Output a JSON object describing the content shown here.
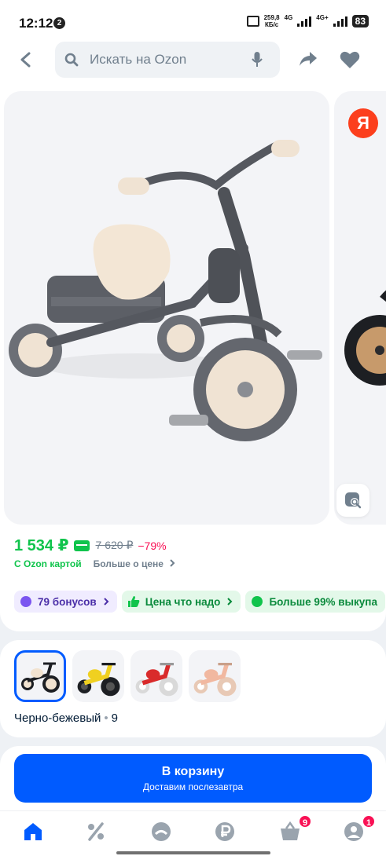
{
  "status_bar": {
    "time": "12:12",
    "notif_count": "2",
    "speed_value": "259,8",
    "speed_unit": "КБ/с",
    "net1": "4G",
    "net2": "4G+",
    "battery": "83"
  },
  "header": {
    "search_placeholder": "Искать на Ozon"
  },
  "product": {
    "price": "1 534 ₽",
    "old_price": "7 620 ₽",
    "discount": "−79%",
    "card_label": "С Ozon картой",
    "more_price": "Больше о цене"
  },
  "chips": [
    {
      "label": "79 бонусов"
    },
    {
      "label": "Цена что надо"
    },
    {
      "label": "Больше 99% выкупа"
    }
  ],
  "variants": {
    "selected_label": "Черно-бежевый",
    "count": "9",
    "thumbs": [
      {
        "color_name": "black-beige",
        "color": "#f2e3d0"
      },
      {
        "color_name": "yellow",
        "color": "#f0d020"
      },
      {
        "color_name": "red",
        "color": "#d92b2b"
      },
      {
        "color_name": "peach",
        "color": "#f1b8a0"
      }
    ]
  },
  "cart": {
    "button_label": "В корзину",
    "button_sub": "Доставим послезавтра"
  },
  "tabbar": {
    "cart_badge": "9",
    "profile_badge": "1"
  },
  "colors": {
    "accent": "#005bff",
    "price_green": "#10c44c",
    "discount_pink": "#f91155"
  }
}
